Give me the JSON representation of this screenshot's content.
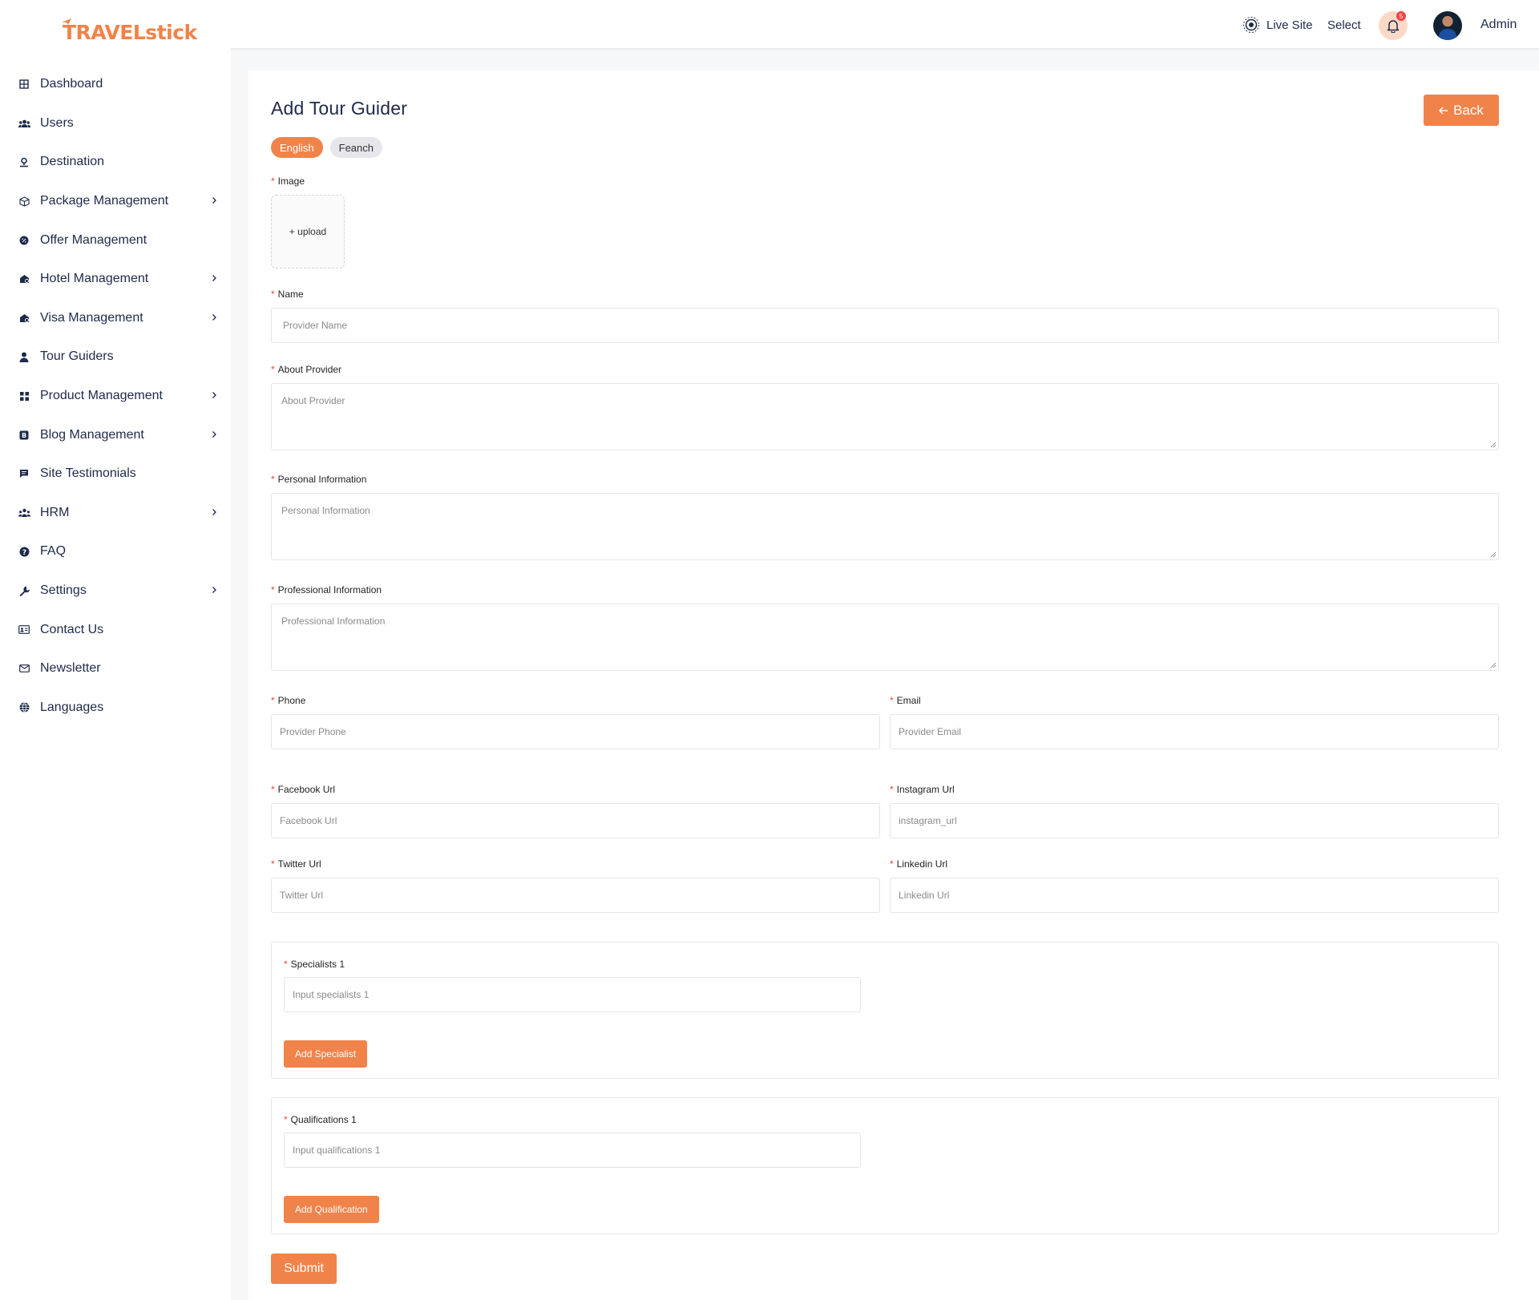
{
  "brand": {
    "logo_text": "TRAVELstick"
  },
  "sidebar": {
    "items": [
      {
        "label": "Dashboard",
        "icon": "dashboard-icon",
        "chevron": false
      },
      {
        "label": "Users",
        "icon": "users-icon",
        "chevron": false
      },
      {
        "label": "Destination",
        "icon": "location-icon",
        "chevron": false
      },
      {
        "label": "Package Management",
        "icon": "package-icon",
        "chevron": true
      },
      {
        "label": "Offer Management",
        "icon": "offer-icon",
        "chevron": false
      },
      {
        "label": "Hotel Management",
        "icon": "hotel-icon",
        "chevron": true
      },
      {
        "label": "Visa Management",
        "icon": "visa-icon",
        "chevron": true
      },
      {
        "label": "Tour Guiders",
        "icon": "guide-icon",
        "chevron": false
      },
      {
        "label": "Product Management",
        "icon": "product-icon",
        "chevron": true
      },
      {
        "label": "Blog Management",
        "icon": "blog-icon",
        "chevron": true
      },
      {
        "label": "Site Testimonials",
        "icon": "testimonial-icon",
        "chevron": false
      },
      {
        "label": "HRM",
        "icon": "hrm-icon",
        "chevron": true
      },
      {
        "label": "FAQ",
        "icon": "question-icon",
        "chevron": false
      },
      {
        "label": "Settings",
        "icon": "wrench-icon",
        "chevron": true
      },
      {
        "label": "Contact Us",
        "icon": "contact-card-icon",
        "chevron": false
      },
      {
        "label": "Newsletter",
        "icon": "mail-icon",
        "chevron": false
      },
      {
        "label": "Languages",
        "icon": "globe-icon",
        "chevron": false
      }
    ]
  },
  "header": {
    "live_site": "Live Site",
    "select": "Select",
    "notification_count": "5",
    "user_name": "Admin"
  },
  "page": {
    "title": "Add Tour Guider",
    "back_label": "Back",
    "tabs": [
      {
        "label": "English",
        "active": true
      },
      {
        "label": "Feanch",
        "active": false
      }
    ]
  },
  "form": {
    "image_label": "Image",
    "upload_label": "+ upload",
    "name": {
      "label": "Name",
      "placeholder": "Provider Name"
    },
    "about": {
      "label": "About Provider",
      "placeholder": "About Provider"
    },
    "personal": {
      "label": "Personal Information",
      "placeholder": "Personal Information"
    },
    "professional": {
      "label": "Professional Information",
      "placeholder": "Professional Information"
    },
    "phone": {
      "label": "Phone",
      "placeholder": "Provider Phone"
    },
    "email": {
      "label": "Email",
      "placeholder": "Provider Email"
    },
    "facebook": {
      "label": "Facebook Url",
      "placeholder": "Facebook Url"
    },
    "instagram": {
      "label": "Instagram Url",
      "placeholder": "instagram_url"
    },
    "twitter": {
      "label": "Twitter Url",
      "placeholder": "Twitter Url"
    },
    "linkedin": {
      "label": "Linkedin Url",
      "placeholder": "Linkedin Url"
    },
    "specialists": {
      "label": "Specialists 1",
      "placeholder": "Input specialists 1",
      "button": "Add Specialist"
    },
    "qualifications": {
      "label": "Qualifications 1",
      "placeholder": "Input qualifications 1",
      "button": "Add Qualification"
    },
    "submit": "Submit"
  },
  "colors": {
    "accent": "#f0834a",
    "required": "#ef4444",
    "text_dark": "#1e2a4a"
  }
}
